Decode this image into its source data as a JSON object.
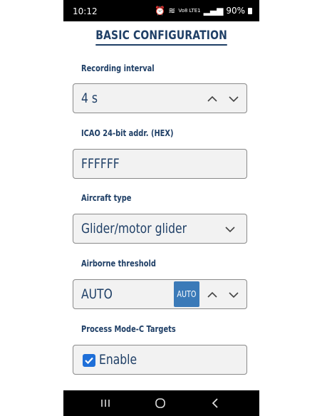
{
  "status_bar": {
    "time": "10:12",
    "network": "Vo8 LTE1",
    "battery": "90%"
  },
  "page": {
    "title": "BASIC CONFIGURATION"
  },
  "fields": {
    "recording_interval": {
      "label": "Recording interval",
      "value": "4 s"
    },
    "icao_address": {
      "label": "ICAO 24-bit addr. (HEX)",
      "value": "FFFFFF"
    },
    "aircraft_type": {
      "label": "Aircraft type",
      "value": "Glider/motor glider"
    },
    "airborne_threshold": {
      "label": "Airborne threshold",
      "value": "AUTO",
      "badge": "AUTO"
    },
    "process_mode_c": {
      "label": "Process Mode-C Targets",
      "checkbox_label": "Enable",
      "checked": true
    }
  },
  "colors": {
    "label_text": "#1f3f66",
    "badge_bg": "#3b7ab8",
    "checkbox_bg": "#1f6fd8",
    "field_bg": "#f2f2f2"
  },
  "icons": {
    "up": "chevron-up-icon",
    "down": "chevron-down-icon",
    "check": "checkmark-icon",
    "nav_recent": "recent-apps-icon",
    "nav_home": "home-icon",
    "nav_back": "back-icon"
  }
}
